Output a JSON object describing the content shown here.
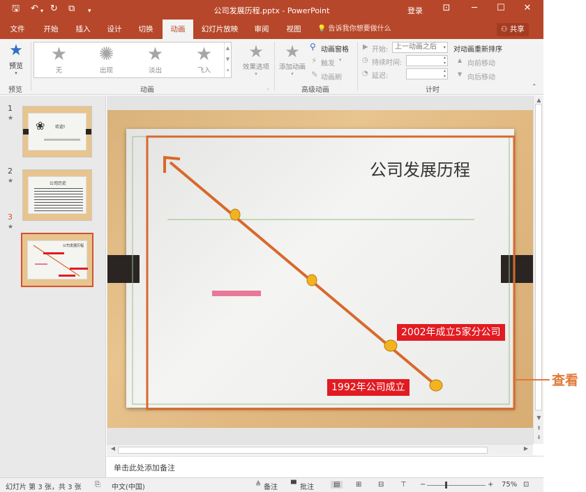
{
  "window": {
    "title": "公司发展历程.pptx - PowerPoint",
    "login": "登录",
    "icons": [
      "save-icon",
      "undo-icon",
      "redo-icon",
      "customize-icon"
    ]
  },
  "tabs": [
    {
      "label": "文件"
    },
    {
      "label": "开始"
    },
    {
      "label": "插入"
    },
    {
      "label": "设计"
    },
    {
      "label": "切换"
    },
    {
      "label": "动画",
      "active": true
    },
    {
      "label": "幻灯片放映"
    },
    {
      "label": "审阅"
    },
    {
      "label": "视图"
    }
  ],
  "tellme": "告诉我你想要做什么",
  "share": "共享",
  "ribbon": {
    "preview": {
      "button": "预览",
      "group": "预览"
    },
    "animation": {
      "gallery": [
        "无",
        "出现",
        "淡出",
        "飞入"
      ],
      "effect_options": "效果选项",
      "group": "动画"
    },
    "advanced": {
      "add_animation": "添加动画",
      "animation_pane": "动画窗格",
      "trigger": "触发",
      "painter": "动画刷",
      "group": "高级动画"
    },
    "timing": {
      "start_label": "开始:",
      "start_value": "上一动画之后",
      "duration_label": "持续时间:",
      "delay_label": "延迟:",
      "group": "计时"
    },
    "reorder": {
      "title": "对动画重新排序",
      "forward": "向前移动",
      "backward": "向后移动"
    }
  },
  "thumbnails": [
    {
      "num": "1",
      "star": "★",
      "text": "欢迎!"
    },
    {
      "num": "2",
      "star": "★",
      "text": "公司历史"
    },
    {
      "num": "3",
      "star": "★",
      "text": "公司发展历程",
      "selected": true
    }
  ],
  "slide": {
    "title": "公司发展历程",
    "label_2002": "2002年成立5家分公司",
    "label_1992": "1992年公司成立"
  },
  "notes_placeholder": "单击此处添加备注",
  "status": {
    "slide_info": "幻灯片 第 3 张，共 3 张",
    "language": "中文(中国)",
    "notes": "备注",
    "comments": "批注",
    "zoom": "75%"
  },
  "callout": "查看",
  "colors": {
    "accent": "#b7472a",
    "path_line": "#d8692c",
    "red_label": "#e11b22",
    "dot": "#f2b41e"
  }
}
